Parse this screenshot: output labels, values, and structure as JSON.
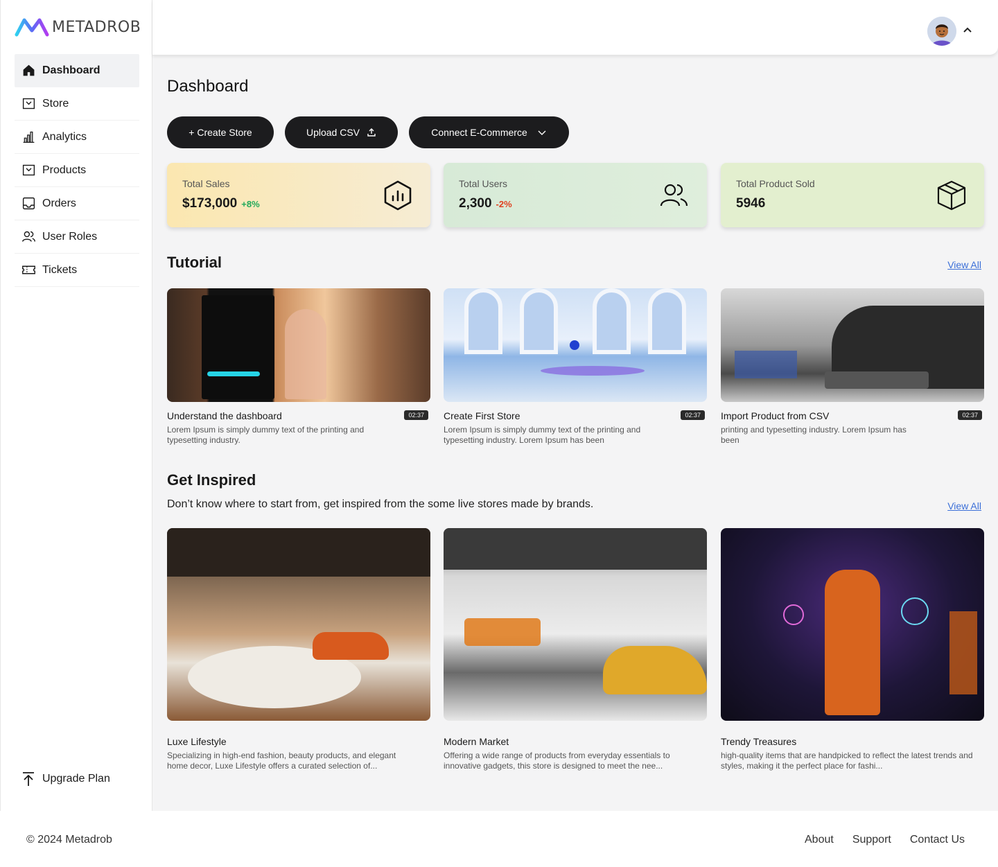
{
  "brand": {
    "name": "METADROB"
  },
  "sidebar": {
    "items": [
      {
        "label": "Dashboard",
        "icon": "home-icon",
        "active": true
      },
      {
        "label": "Store",
        "icon": "store-icon"
      },
      {
        "label": "Analytics",
        "icon": "analytics-icon"
      },
      {
        "label": "Products",
        "icon": "products-icon"
      },
      {
        "label": "Orders",
        "icon": "orders-icon"
      },
      {
        "label": "User Roles",
        "icon": "user-roles-icon"
      },
      {
        "label": "Tickets",
        "icon": "ticket-icon"
      }
    ],
    "upgrade_label": "Upgrade Plan"
  },
  "page": {
    "title": "Dashboard"
  },
  "actions": {
    "create_store": "+ Create Store",
    "upload_csv": "Upload CSV",
    "connect_ecommerce": "Connect E-Commerce"
  },
  "stats": [
    {
      "label": "Total Sales",
      "value": "$173,000",
      "change": "+8%",
      "change_color": "#22a95a"
    },
    {
      "label": "Total Users",
      "value": "2,300",
      "change": "-2%",
      "change_color": "#e0401f"
    },
    {
      "label": "Total Product Sold",
      "value": "5946",
      "change": ""
    }
  ],
  "tutorial": {
    "title": "Tutorial",
    "view_all": "View All",
    "cards": [
      {
        "title": "Understand the dashboard",
        "duration": "02:37",
        "desc": "Lorem Ipsum is simply dummy text of the printing and typesetting industry."
      },
      {
        "title": "Create First Store",
        "duration": "02:37",
        "desc": "Lorem Ipsum is simply dummy text of the printing and typesetting industry. Lorem Ipsum has been"
      },
      {
        "title": "Import Product from CSV",
        "duration": "02:37",
        "desc": "printing and typesetting industry. Lorem Ipsum has been"
      }
    ]
  },
  "inspired": {
    "title": "Get Inspired",
    "subtitle": "Don’t know where to start from, get inspired from the some live stores made by brands.",
    "view_all": "View All",
    "cards": [
      {
        "title": "Luxe Lifestyle",
        "desc": "Specializing in high-end fashion, beauty products, and elegant home decor, Luxe Lifestyle offers a curated selection of..."
      },
      {
        "title": "Modern Market",
        "desc": "Offering a wide range of products from everyday essentials to innovative gadgets, this store is designed to meet the nee..."
      },
      {
        "title": "Trendy Treasures",
        "desc": "high-quality items that are handpicked to reflect the latest trends and styles, making it the perfect place for fashi..."
      }
    ]
  },
  "footer": {
    "copyright": "© 2024  Metadrob",
    "links": [
      "About",
      "Support",
      "Contact Us"
    ]
  },
  "colors": {
    "accent_dark": "#1c1c1e",
    "link": "#3b6fd8",
    "positive": "#22a95a",
    "negative": "#e0401f"
  }
}
